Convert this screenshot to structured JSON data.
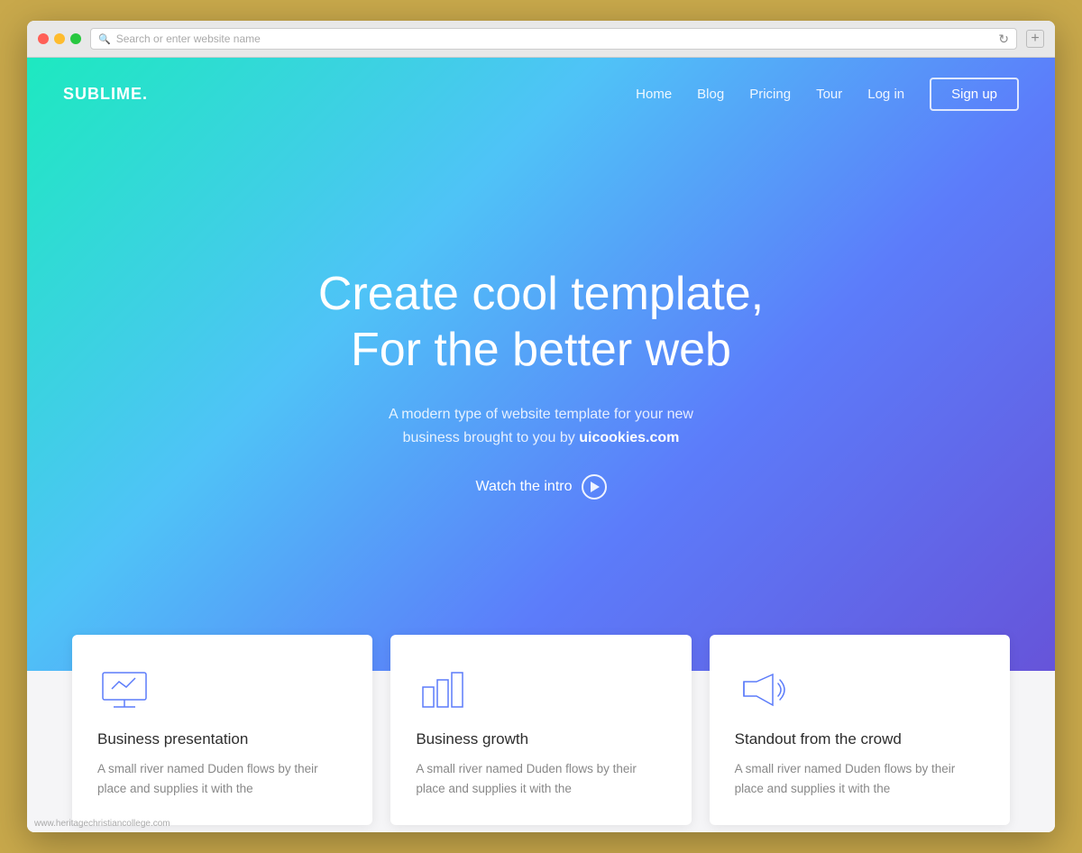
{
  "browser": {
    "address_placeholder": "Search or enter website name",
    "new_tab_label": "+"
  },
  "navbar": {
    "logo": "SUBLIME.",
    "links": [
      "Home",
      "Blog",
      "Pricing",
      "Tour",
      "Log in"
    ],
    "signup": "Sign up"
  },
  "hero": {
    "title_line1": "Create cool template,",
    "title_line2": "For the better web",
    "subtitle_line1": "A modern type of website template for your new",
    "subtitle_line2": "business brought to you by",
    "subtitle_link": "uicookies.com",
    "watch_intro": "Watch the intro"
  },
  "cards": [
    {
      "icon": "presentation",
      "title": "Business presentation",
      "text": "A small river named Duden flows by their place and supplies it with the"
    },
    {
      "icon": "chart",
      "title": "Business growth",
      "text": "A small river named Duden flows by their place and supplies it with the"
    },
    {
      "icon": "megaphone",
      "title": "Standout from the crowd",
      "text": "A small river named Duden flows by their place and supplies it with the"
    }
  ],
  "watermark": "www.heritagechristiancollege.com"
}
